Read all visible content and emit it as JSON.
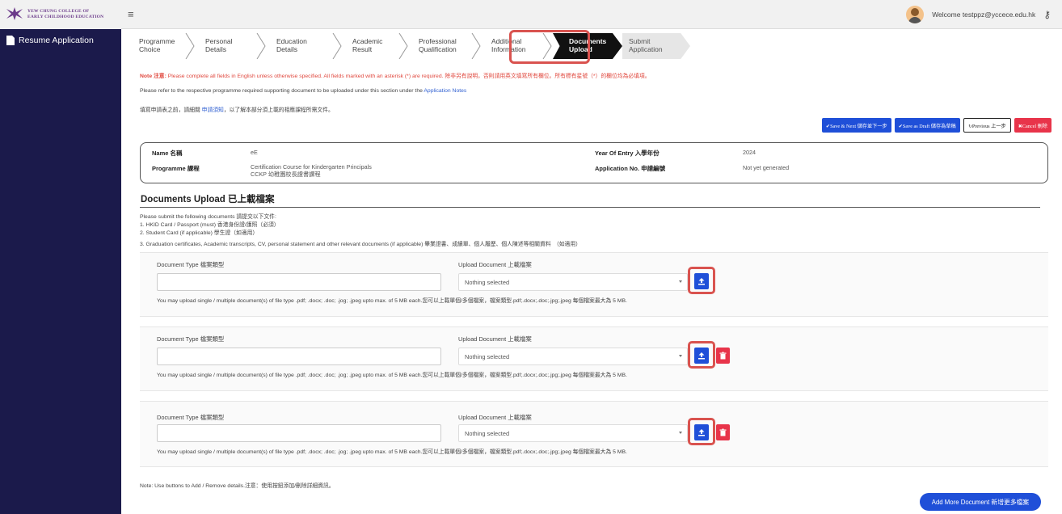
{
  "header": {
    "logo_line1": "YEW CHUNG COLLEGE OF",
    "logo_line2": "EARLY CHILDHOOD EDUCATION",
    "welcome": "Welcome testppz@yccece.edu.hk"
  },
  "sidebar": {
    "items": [
      {
        "label": "Resume Application",
        "icon": "document-icon"
      }
    ]
  },
  "steps": [
    {
      "line1": "Programme",
      "line2": "Choice",
      "state": "done"
    },
    {
      "line1": "Personal",
      "line2": "Details",
      "state": "done"
    },
    {
      "line1": "Education",
      "line2": "Details",
      "state": "done"
    },
    {
      "line1": "Academic",
      "line2": "Result",
      "state": "done"
    },
    {
      "line1": "Professional",
      "line2": "Qualification",
      "state": "done"
    },
    {
      "line1": "Additional",
      "line2": "Information",
      "state": "done"
    },
    {
      "line1": "Documents",
      "line2": "Upload",
      "state": "active"
    },
    {
      "line1": "Submit",
      "line2": "Application",
      "state": "pending"
    }
  ],
  "notes": {
    "note_label": "Note 注意:",
    "note_text": " Please complete all fields in English unless otherwise specified. All fields marked with an asterisk (*) are required. 除非另有說明，否則請用英文填寫所有欄位。所有標有星號（*）的欄位均為必填項。",
    "refer_prefix": "Please refer to the respective programme required supporting document to be uploaded under this section under the ",
    "refer_link": "Application Notes",
    "zh_prefix": "填寫申請表之前，請細閱 ",
    "zh_link": "申請須知",
    "zh_suffix": "，以了解本部分須上載的相應課程所需文件。"
  },
  "actions": {
    "save_next": "✔Save & Next 儲存並下一步",
    "save_draft": "✔Save as Draft 儲存為草稿",
    "previous": "↻Previous 上一步",
    "cancel": "✖Cancel 刪除"
  },
  "info": {
    "name_label": "Name 名稱",
    "name_value": "eE",
    "programme_label": "Programme 課程",
    "programme_value1": "Certification Course for Kindergarten Principals",
    "programme_value2": "CCKP 幼稚園校長證書課程",
    "year_label": "Year Of Entry 入學年份",
    "year_value": "2024",
    "appno_label": "Application No. 申請編號",
    "appno_value": "Not yet generated"
  },
  "upload": {
    "title": "Documents Upload 已上載檔案",
    "instructions": [
      "Please submit the following documents 請提交以下文件:",
      "1.  HKID Card / Passport (must) 香港身份證/護照（必須）",
      "2.  Student Card (if applicable) 學生證（如適用）",
      "3.  Graduation certificates, Academic transcripts, CV, personal statement and other relevant documents (if applicable) 畢業證書、成績單、個人履歷、個人陳述等相關資料　（如適用）"
    ],
    "doc_type_label": "Document Type 檔案類型",
    "upload_label": "Upload Document 上載檔案",
    "select_placeholder": "Nothing selected",
    "hint": "You may upload single / multiple document(s) of file type .pdf; .docx; .doc; .jog; .jpeg upto max. of 5 MB each.您可以上載單個/多個檔案，檔案類型.pdf;.docx;.doc;.jpg;.jpeg 每個檔案最大為 5 MB.",
    "footer_note": "Note: Use buttons to Add / Remove details.注意：使用按鈕添加/刪除詳細資訊。",
    "add_more": "Add More Document 新增更多檔案"
  }
}
